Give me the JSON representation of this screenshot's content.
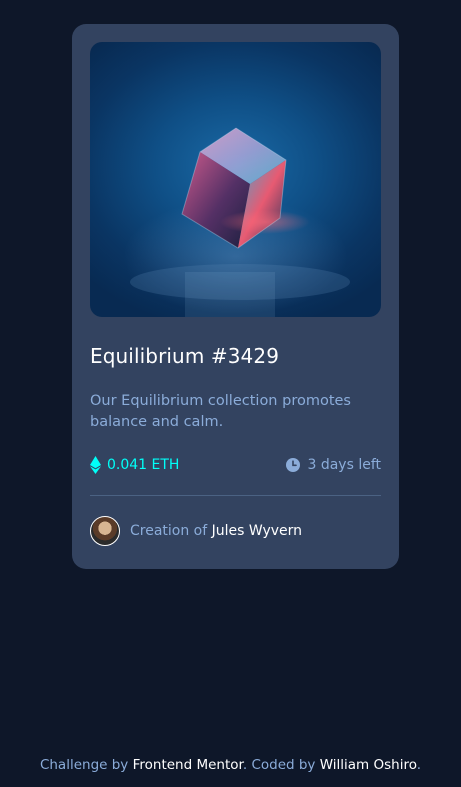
{
  "card": {
    "title": "Equilibrium #3429",
    "description": "Our Equilibrium collection promotes balance and calm.",
    "price": "0.041 ETH",
    "time_left": "3 days left",
    "creator_prefix": "Creation of",
    "creator_name": "Jules Wyvern"
  },
  "attribution": {
    "challenge_by": "Challenge by",
    "frontend_mentor": "Frontend Mentor",
    "sep": ". ",
    "coded_by": "Coded by",
    "author": "William Oshiro",
    "end": "."
  },
  "colors": {
    "background": "#0e1729",
    "card": "#334360",
    "cyan": "#00fff8",
    "soft_blue": "#8bacd9",
    "white": "#ffffff"
  },
  "icons": [
    "ethereum-icon",
    "clock-icon"
  ]
}
